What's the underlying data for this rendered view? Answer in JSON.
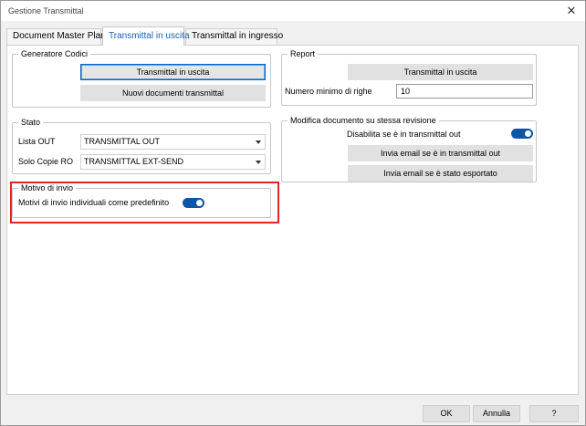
{
  "window": {
    "title": "Gestione Transmittal",
    "close_glyph": "✕"
  },
  "tabs": [
    {
      "label": "Document Master Plan"
    },
    {
      "label": "Transmittal in uscita"
    },
    {
      "label": "Transmittal in ingresso"
    }
  ],
  "generatore": {
    "legend": "Generatore Codici",
    "btn_uscita": "Transmittal in uscita",
    "btn_nuovi": "Nuovi documenti transmittal"
  },
  "report": {
    "legend": "Report",
    "btn_uscita": "Transmittal in uscita",
    "min_rows_label": "Numero minimo di righe",
    "min_rows_value": "10"
  },
  "stato": {
    "legend": "Stato",
    "lista_out_label": "Lista OUT",
    "lista_out_value": "TRANSMITTAL OUT",
    "solo_copie_label": "Solo Copie RO",
    "solo_copie_value": "TRANSMITTAL EXT-SEND"
  },
  "modifica": {
    "legend": "Modifica documento su stessa revisione",
    "disabilita_label": "Disabilita se è in transmittal out",
    "btn_email_out": "Invia email se è in transmittal out",
    "btn_email_esportato": "Invia email se è stato esportato"
  },
  "motivo": {
    "legend": "Motivo di invio",
    "individuali_label": "Motivi di invio individuali come predefinito"
  },
  "footer": {
    "ok": "OK",
    "annulla": "Annulla",
    "help": "?"
  },
  "colors": {
    "accent": "#1c5fb3",
    "toggle_on": "#0c56a5",
    "highlight": "#e0262b"
  }
}
